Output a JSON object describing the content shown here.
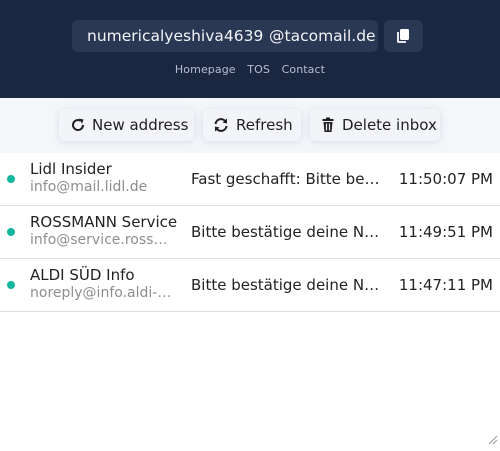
{
  "header": {
    "address_user": "numericalyeshiva4639",
    "address_domain": "@tacomail.de",
    "copy_icon": "copy-icon",
    "links": [
      "Homepage",
      "TOS",
      "Contact"
    ]
  },
  "toolbar": {
    "new_address": "New address",
    "refresh": "Refresh",
    "delete_inbox": "Delete inbox"
  },
  "messages": [
    {
      "sender": "Lidl Insider",
      "email": "info@mail.lidl.de",
      "subject": "Fast geschafft: Bitte bestätige deine Newsletter-Anmeldung",
      "time": "11:50:07 PM",
      "unread": true
    },
    {
      "sender": "ROSSMANN Service",
      "email": "info@service.rossmann.de",
      "subject": "Bitte bestätige deine Newsletter-Anmeldung",
      "time": "11:49:51 PM",
      "unread": true
    },
    {
      "sender": "ALDI SÜD Info",
      "email": "noreply@info.aldi-sued.de",
      "subject": "Bitte bestätige deine Newsletter-Anmeldung",
      "time": "11:47:11 PM",
      "unread": true
    }
  ],
  "colors": {
    "header_bg": "#1b2640",
    "field_bg": "#2b3853",
    "unread_dot": "#13b79d"
  }
}
